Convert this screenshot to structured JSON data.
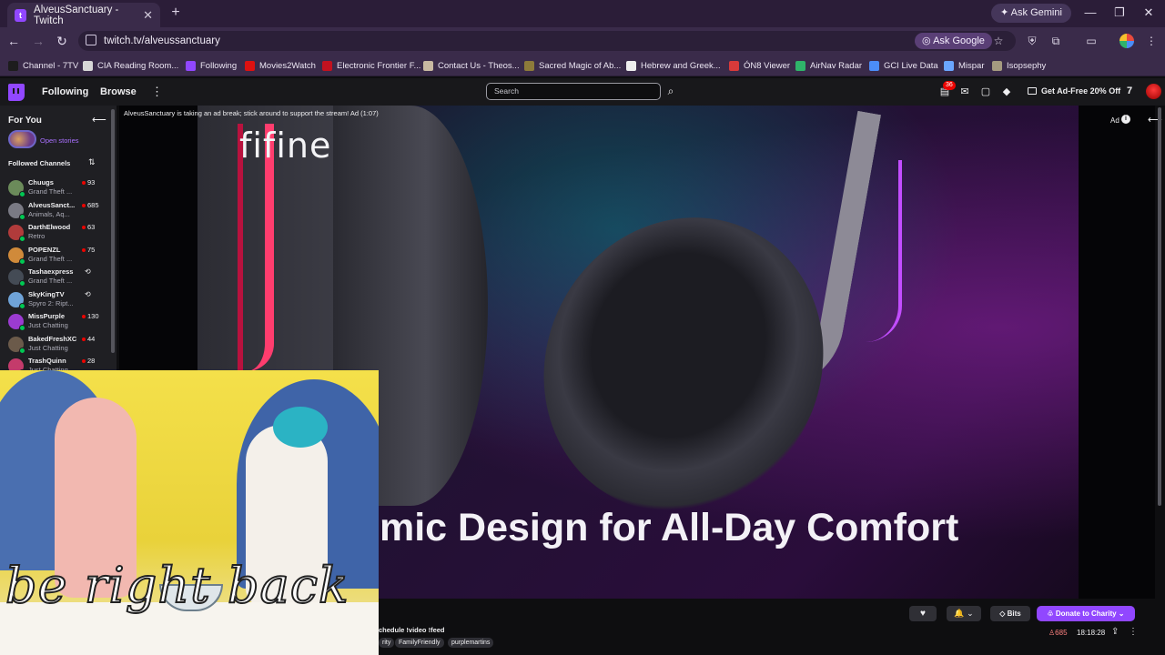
{
  "browser": {
    "tab_title": "AlveusSanctuary - Twitch",
    "tab_close": "✕",
    "new_tab": "+",
    "ask_gemini": "Ask Gemini",
    "url": "twitch.tv/alveussanctuary",
    "ask_google": "Ask Google",
    "window_controls": {
      "minimize": "—",
      "restore": "❐",
      "close": "✕"
    },
    "nav": {
      "back": "←",
      "forward": "→",
      "reload": "↻"
    },
    "bookmarks": [
      {
        "label": "Channel - 7TV",
        "color": "#1d1d1d"
      },
      {
        "label": "CIA Reading Room...",
        "color": "#d7d7d7"
      },
      {
        "label": "Following",
        "color": "#9147ff"
      },
      {
        "label": "Movies2Watch",
        "color": "#d11"
      },
      {
        "label": "Electronic Frontier F...",
        "color": "#c2121f"
      },
      {
        "label": "Contact Us - Theos...",
        "color": "#c8b9a2"
      },
      {
        "label": "Sacred Magic of Ab...",
        "color": "#8d7a3a"
      },
      {
        "label": "Hebrew and Greek...",
        "color": "#eeeeee"
      },
      {
        "label": "ÓN8 Viewer",
        "color": "#d83a3a"
      },
      {
        "label": "AirNav Radar",
        "color": "#2fb36a"
      },
      {
        "label": "GCI Live Data",
        "color": "#4b8df8"
      },
      {
        "label": "Mispar",
        "color": "#6aa6ff"
      },
      {
        "label": "Isopsephy",
        "color": "#a59a80"
      }
    ]
  },
  "twitch_nav": {
    "following": "Following",
    "browse": "Browse",
    "more": "⋮",
    "search_placeholder": "Search",
    "notification_count": "36",
    "ad_free": "Get Ad-Free 20% Off"
  },
  "sidebar": {
    "for_you": "For You",
    "open_stories": "Open stories",
    "followed_header": "Followed Channels",
    "channels": [
      {
        "name": "Chuugs",
        "game": "Grand Theft ...",
        "viewers": "93",
        "color": "#6b8b5a"
      },
      {
        "name": "AlveusSanct...",
        "game": "Animals, Aq...",
        "viewers": "685",
        "color": "#7a7a84"
      },
      {
        "name": "DarthElwood",
        "game": "Retro",
        "viewers": "63",
        "color": "#b13b3b"
      },
      {
        "name": "POPENZL",
        "game": "Grand Theft ...",
        "viewers": "75",
        "color": "#d08a3a"
      },
      {
        "name": "Tashaexpress",
        "game": "Grand Theft ...",
        "viewers": "",
        "color": "#444b55"
      },
      {
        "name": "SkyKingTV",
        "game": "Spyro 2: Ript...",
        "viewers": "",
        "color": "#6fa3d8"
      },
      {
        "name": "MissPurple",
        "game": "Just Chatting",
        "viewers": "130",
        "color": "#9b3bd1"
      },
      {
        "name": "BakedFreshXC",
        "game": "Just Chatting",
        "viewers": "44",
        "color": "#6b5a4a"
      },
      {
        "name": "TrashQuinn",
        "game": "Just Chatting",
        "viewers": "28",
        "color": "#c43b6b"
      }
    ]
  },
  "video": {
    "ad_notice": "AlveusSanctuary is taking an ad break; stick around to support the stream! Ad (1:07)",
    "ad_label": "Ad",
    "ad_info": "i",
    "brand": "fifine",
    "tagline": "mic Design for All-Day Comfort"
  },
  "brb": {
    "text": "be right back"
  },
  "bottom": {
    "schedule": "chedule !video !feed",
    "tags": [
      "rity",
      "FamilyFriendly",
      "purplemartins"
    ],
    "bits": "Bits",
    "donate": "Donate to Charity",
    "viewers": "685",
    "uptime": "18:18:28"
  }
}
